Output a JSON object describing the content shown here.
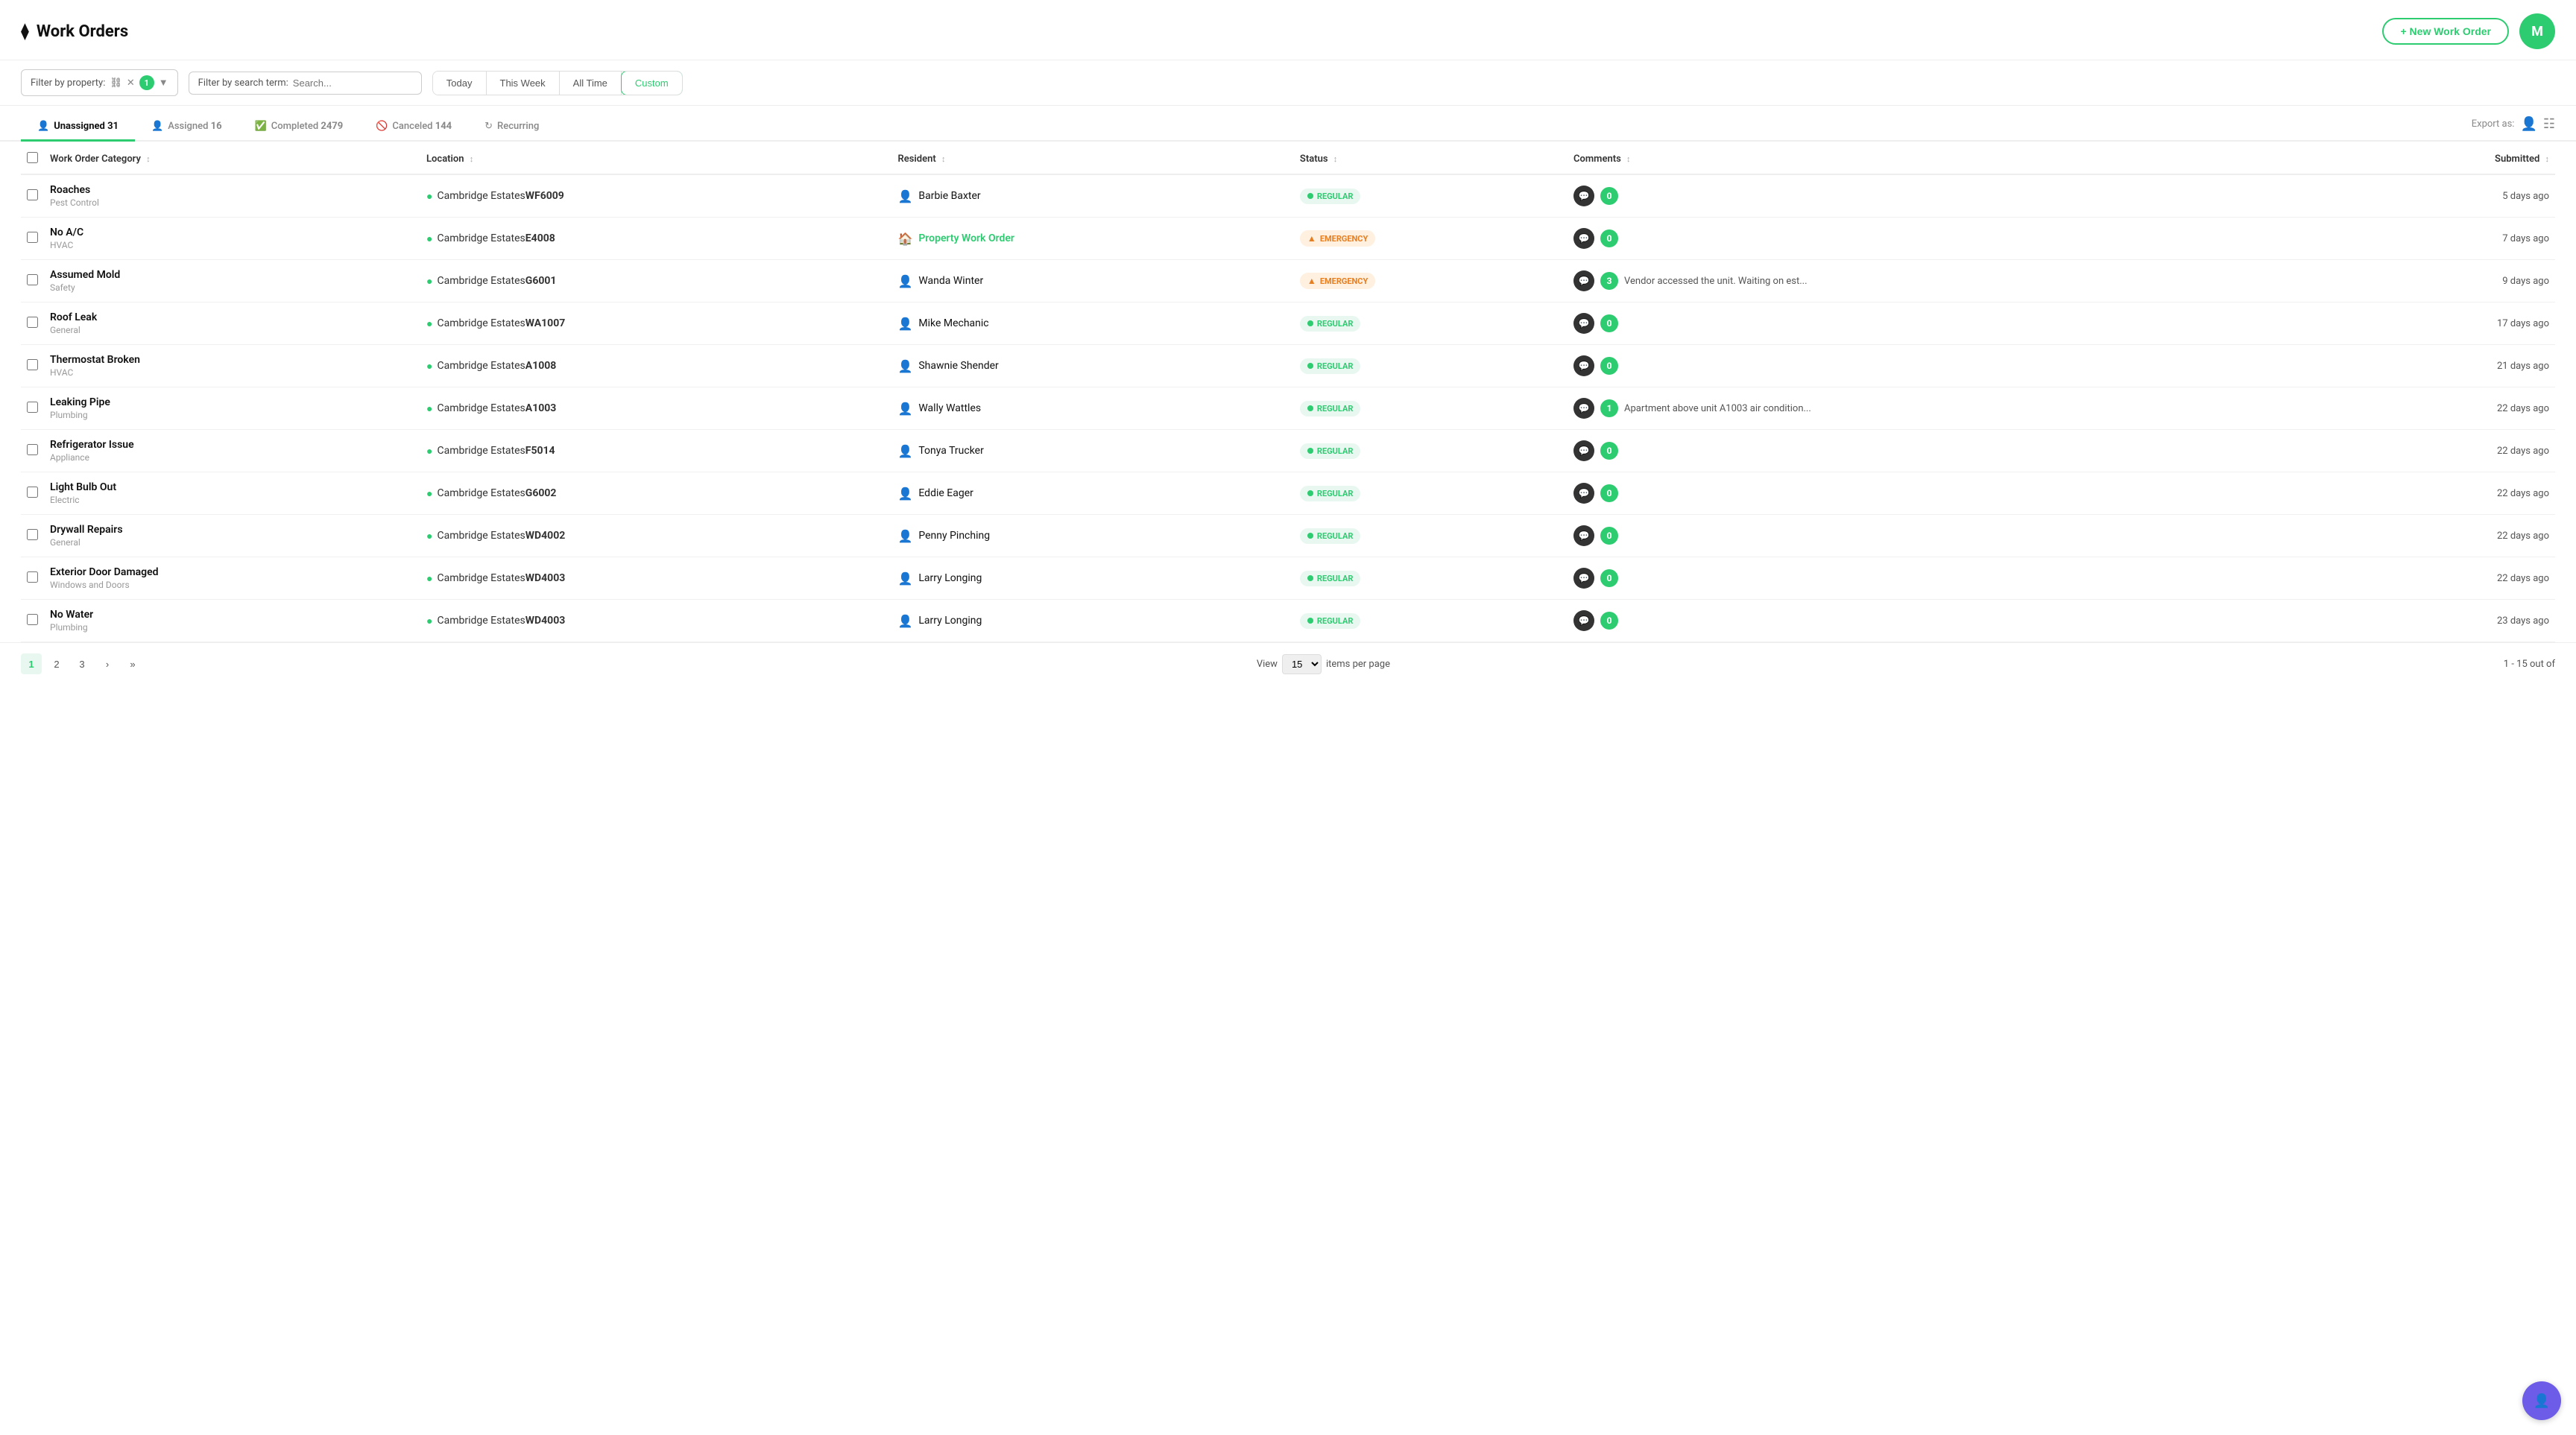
{
  "header": {
    "title": "Work Orders",
    "new_button": "+ New Work Order",
    "avatar_initials": "M"
  },
  "filters": {
    "property_label": "Filter by property:",
    "property_badge": "1",
    "search_label": "Filter by search term:",
    "search_placeholder": "Search...",
    "time_buttons": [
      "Today",
      "This Week",
      "All Time",
      "Custom"
    ],
    "active_time": "Custom"
  },
  "tabs": [
    {
      "id": "unassigned",
      "label": "Unassigned",
      "count": "31",
      "active": true
    },
    {
      "id": "assigned",
      "label": "Assigned",
      "count": "16",
      "active": false
    },
    {
      "id": "completed",
      "label": "Completed",
      "count": "2479",
      "active": false
    },
    {
      "id": "canceled",
      "label": "Canceled",
      "count": "144",
      "active": false
    },
    {
      "id": "recurring",
      "label": "Recurring",
      "count": "",
      "active": false
    }
  ],
  "export_label": "Export as:",
  "table": {
    "columns": [
      {
        "id": "category",
        "label": "Work Order Category"
      },
      {
        "id": "location",
        "label": "Location"
      },
      {
        "id": "resident",
        "label": "Resident"
      },
      {
        "id": "status",
        "label": "Status"
      },
      {
        "id": "comments",
        "label": "Comments"
      },
      {
        "id": "submitted",
        "label": "Submitted"
      }
    ],
    "rows": [
      {
        "category_title": "Roaches",
        "category_sub": "Pest Control",
        "location": "Cambridge Estates",
        "location_unit": "WF6009",
        "resident": "Barbie Baxter",
        "resident_type": "person",
        "status": "REGULAR",
        "status_type": "regular",
        "comment_text": "",
        "comment_count": "0",
        "submitted": "5 days ago"
      },
      {
        "category_title": "No A/C",
        "category_sub": "HVAC",
        "location": "Cambridge Estates",
        "location_unit": "E4008",
        "resident": "Property Work Order",
        "resident_type": "property",
        "status": "EMERGENCY",
        "status_type": "emergency",
        "comment_text": "",
        "comment_count": "0",
        "submitted": "7 days ago"
      },
      {
        "category_title": "Assumed Mold",
        "category_sub": "Safety",
        "location": "Cambridge Estates",
        "location_unit": "G6001",
        "resident": "Wanda Winter",
        "resident_type": "person",
        "status": "EMERGENCY",
        "status_type": "emergency",
        "comment_text": "Vendor accessed the unit. Waiting on est...",
        "comment_count": "3",
        "submitted": "9 days ago"
      },
      {
        "category_title": "Roof Leak",
        "category_sub": "General",
        "location": "Cambridge Estates",
        "location_unit": "WA1007",
        "resident": "Mike Mechanic",
        "resident_type": "person",
        "status": "REGULAR",
        "status_type": "regular",
        "comment_text": "",
        "comment_count": "0",
        "submitted": "17 days ago"
      },
      {
        "category_title": "Thermostat Broken",
        "category_sub": "HVAC",
        "location": "Cambridge Estates",
        "location_unit": "A1008",
        "resident": "Shawnie Shender",
        "resident_type": "person",
        "status": "REGULAR",
        "status_type": "regular",
        "comment_text": "",
        "comment_count": "0",
        "submitted": "21 days ago"
      },
      {
        "category_title": "Leaking Pipe",
        "category_sub": "Plumbing",
        "location": "Cambridge Estates",
        "location_unit": "A1003",
        "resident": "Wally Wattles",
        "resident_type": "person",
        "status": "REGULAR",
        "status_type": "regular",
        "comment_text": "Apartment above unit A1003 air condition...",
        "comment_count": "1",
        "submitted": "22 days ago"
      },
      {
        "category_title": "Refrigerator Issue",
        "category_sub": "Appliance",
        "location": "Cambridge Estates",
        "location_unit": "F5014",
        "resident": "Tonya Trucker",
        "resident_type": "person",
        "status": "REGULAR",
        "status_type": "regular",
        "comment_text": "",
        "comment_count": "0",
        "submitted": "22 days ago"
      },
      {
        "category_title": "Light Bulb Out",
        "category_sub": "Electric",
        "location": "Cambridge Estates",
        "location_unit": "G6002",
        "resident": "Eddie Eager",
        "resident_type": "person",
        "status": "REGULAR",
        "status_type": "regular",
        "comment_text": "",
        "comment_count": "0",
        "submitted": "22 days ago"
      },
      {
        "category_title": "Drywall Repairs",
        "category_sub": "General",
        "location": "Cambridge Estates",
        "location_unit": "WD4002",
        "resident": "Penny Pinching",
        "resident_type": "person",
        "status": "REGULAR",
        "status_type": "regular",
        "comment_text": "",
        "comment_count": "0",
        "submitted": "22 days ago"
      },
      {
        "category_title": "Exterior Door Damaged",
        "category_sub": "Windows and Doors",
        "location": "Cambridge Estates",
        "location_unit": "WD4003",
        "resident": "Larry Longing",
        "resident_type": "person",
        "status": "REGULAR",
        "status_type": "regular",
        "comment_text": "",
        "comment_count": "0",
        "submitted": "22 days ago"
      },
      {
        "category_title": "No Water",
        "category_sub": "Plumbing",
        "location": "Cambridge Estates",
        "location_unit": "WD4003",
        "resident": "Larry Longing",
        "resident_type": "person",
        "status": "REGULAR",
        "status_type": "regular",
        "comment_text": "",
        "comment_count": "0",
        "submitted": "23 days ago"
      }
    ]
  },
  "pagination": {
    "pages": [
      "1",
      "2",
      "3"
    ],
    "active_page": "1",
    "per_page": "15",
    "per_page_label": "items per page",
    "view_label": "View",
    "range_label": "1 - 15 out of"
  }
}
